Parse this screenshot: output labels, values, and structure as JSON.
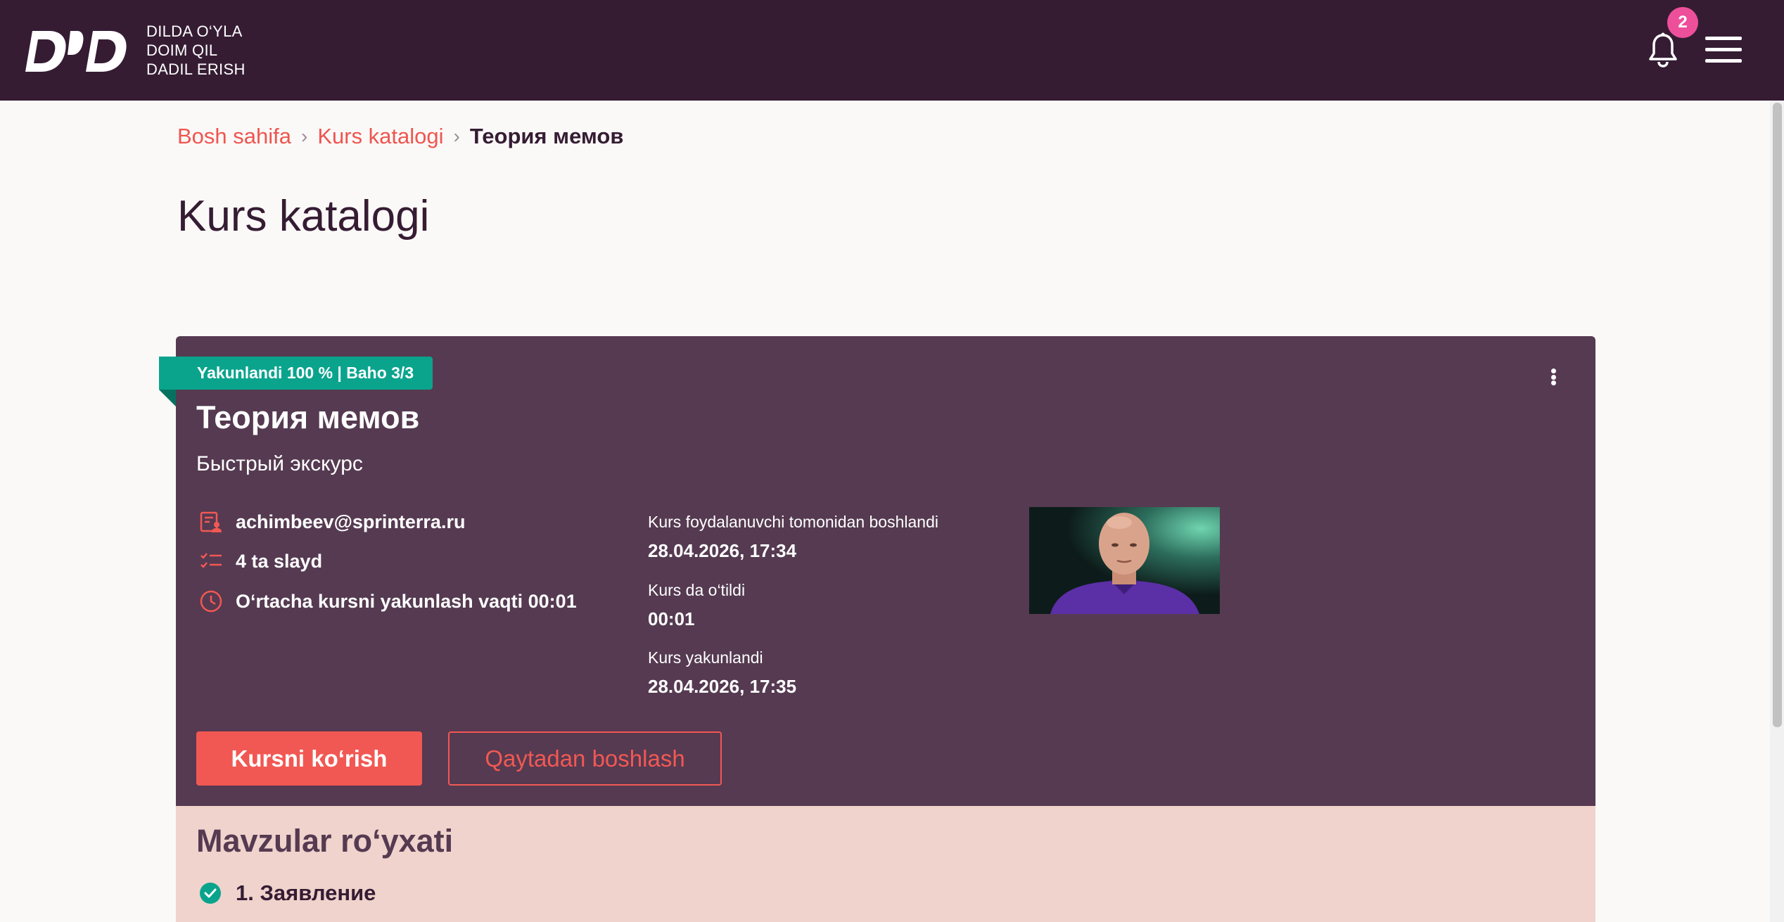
{
  "header": {
    "logo_text": "D’D",
    "slogan": [
      "DILDA O‘YLA",
      "DOIM QIL",
      "DADIL ERISH"
    ],
    "notification_count": "2",
    "colors": {
      "bar": "#351c33",
      "badge": "#ee4f9a"
    }
  },
  "breadcrumb": {
    "items": [
      "Bosh sahifa",
      "Kurs katalogi"
    ],
    "current": "Теория мемов",
    "separator": "›"
  },
  "page": {
    "title": "Kurs katalogi"
  },
  "course": {
    "status_ribbon": "Yakunlandi 100 % | Baho 3/3",
    "title": "Теория мемов",
    "subtitle": "Быстрый экскурс",
    "author": "achimbeev@sprinterra.ru",
    "slides": "4 ta slayd",
    "avg_time": "O‘rtacha kursni yakunlash vaqti 00:01",
    "started_label": "Kurs foydalanuvchi tomonidan boshlandi",
    "started_value": "28.04.2026, 17:34",
    "time_spent_label": "Kurs da o‘tildi",
    "time_spent_value": "00:01",
    "completed_label": "Kurs yakunlandi",
    "completed_value": "28.04.2026, 17:35",
    "view_button": "Kursni ko‘rish",
    "restart_button": "Qaytadan boshlash",
    "colors": {
      "card": "#553a51",
      "ribbon": "#0aa48d",
      "accent": "#f25853"
    }
  },
  "topics": {
    "title": "Mavzular ro‘yxati",
    "items": [
      {
        "label": "1. Заявление",
        "completed": true
      }
    ]
  }
}
